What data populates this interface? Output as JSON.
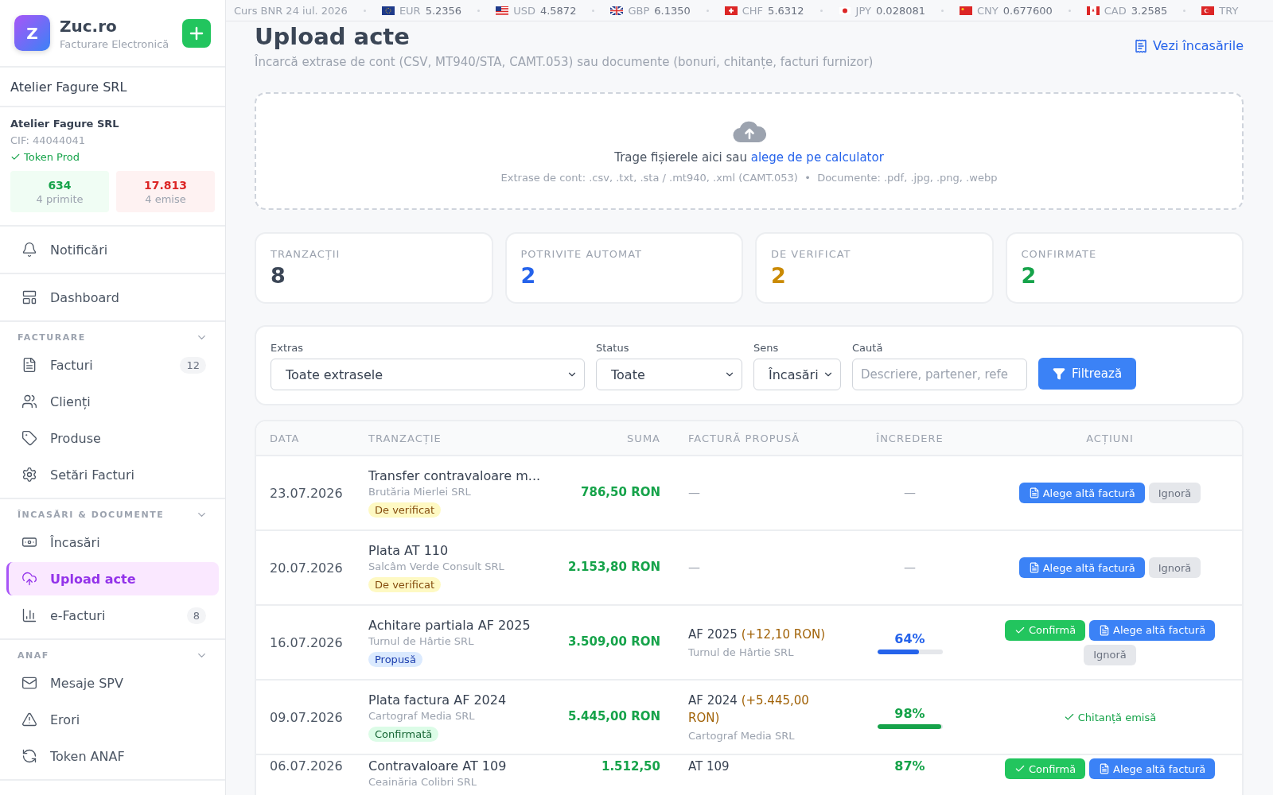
{
  "ticker": {
    "label": "Curs BNR 24 iul. 2026",
    "rates": [
      {
        "code": "EUR",
        "value": "5.2356"
      },
      {
        "code": "USD",
        "value": "4.5872"
      },
      {
        "code": "GBP",
        "value": "6.1350"
      },
      {
        "code": "CHF",
        "value": "5.6312"
      },
      {
        "code": "JPY",
        "value": "0.028081"
      },
      {
        "code": "CNY",
        "value": "0.677600"
      },
      {
        "code": "CAD",
        "value": "3.2585"
      },
      {
        "code": "TRY"
      }
    ]
  },
  "sidebar": {
    "brand": {
      "logo": "Z",
      "name": "Zuc.ro",
      "tagline": "Facturare Electronică"
    },
    "company_selector": "Atelier Fagure SRL",
    "company": {
      "name": "Atelier Fagure SRL",
      "cif": "CIF: 44044041",
      "token": "Token Prod",
      "received": {
        "value": "634",
        "label": "4 primite"
      },
      "issued": {
        "value": "17.813",
        "label": "4 emise"
      }
    },
    "top_items": [
      {
        "label": "Notificări",
        "selected": false
      },
      {
        "label": "Dashboard",
        "selected": false
      }
    ],
    "sections": [
      {
        "title": "FACTURARE",
        "expanded": true,
        "items": [
          {
            "label": "Facturi",
            "count": "12",
            "selected": false
          },
          {
            "label": "Clienți",
            "selected": false
          },
          {
            "label": "Produse",
            "selected": false
          },
          {
            "label": "Setări Facturi",
            "selected": false
          }
        ]
      },
      {
        "title": "ÎNCASĂRI & DOCUMENTE",
        "expanded": true,
        "items": [
          {
            "label": "Încasări",
            "selected": false
          },
          {
            "label": "Upload acte",
            "selected": true
          },
          {
            "label": "e-Facturi",
            "count": "8",
            "selected": false
          }
        ]
      },
      {
        "title": "ANAF",
        "expanded": true,
        "items": [
          {
            "label": "Mesaje SPV",
            "selected": false
          },
          {
            "label": "Erori",
            "selected": false
          },
          {
            "label": "Token ANAF",
            "selected": false
          }
        ]
      }
    ]
  },
  "header": {
    "title": "Upload acte",
    "subtitle": "Încarcă extrase de cont (CSV, MT940/STA, CAMT.053) sau documente (bonuri, chitanțe, facturi furnizor)",
    "link": "Vezi încasările"
  },
  "dropzone": {
    "text": "Trage fișierele aici sau ",
    "link": "alege de pe calculator",
    "hint": "Extrase de cont: .csv, .txt, .sta / .mt940, .xml (CAMT.053)  •  Documente: .pdf, .jpg, .png, .webp"
  },
  "stats": [
    {
      "label": "TRANZACȚII",
      "value": "8",
      "color": "#3b4656"
    },
    {
      "label": "POTRIVITE AUTOMAT",
      "value": "2",
      "color": "#2563eb"
    },
    {
      "label": "DE VERIFICAT",
      "value": "2",
      "color": "#ca8a04"
    },
    {
      "label": "CONFIRMATE",
      "value": "2",
      "color": "#16a34a"
    }
  ],
  "filters": {
    "fields": [
      {
        "kind": "select",
        "label": "Extras",
        "value": "Toate extrasele"
      },
      {
        "kind": "select",
        "label": "Status",
        "value": "Toate"
      },
      {
        "kind": "select",
        "label": "Sens",
        "value": "Încasări"
      },
      {
        "kind": "search",
        "label": "Caută",
        "placeholder": "Descriere, partener, refe"
      }
    ],
    "button": "Filtrează"
  },
  "table": {
    "columns": [
      "DATA",
      "TRANZACȚIE",
      "SUMA",
      "FACTURĂ PROPUSĂ",
      "ÎNCREDERE",
      "ACȚIUNI"
    ],
    "rows": [
      {
        "date": "23.07.2026",
        "title": "Transfer contravaloare m...",
        "partner": "Brutăria Mierlei SRL",
        "status": {
          "kind": "review",
          "label": "De verificat"
        },
        "amount": "786,50 RON",
        "invoice": {
          "kind": "none",
          "text": "—"
        },
        "confidence": {
          "kind": "none",
          "text": "—"
        },
        "actions": [
          {
            "kind": "choose",
            "label": "Alege altă factură"
          },
          {
            "kind": "ignore",
            "label": "Ignoră"
          }
        ]
      },
      {
        "date": "20.07.2026",
        "title": "Plata AT 110",
        "partner": "Salcâm Verde Consult SRL",
        "status": {
          "kind": "review",
          "label": "De verificat"
        },
        "amount": "2.153,80 RON",
        "invoice": {
          "kind": "none",
          "text": "—"
        },
        "confidence": {
          "kind": "none",
          "text": "—"
        },
        "actions": [
          {
            "kind": "choose",
            "label": "Alege altă factură"
          },
          {
            "kind": "ignore",
            "label": "Ignoră"
          }
        ]
      },
      {
        "date": "16.07.2026",
        "title": "Achitare partiala AF 2025",
        "partner": "Turnul de Hârtie SRL",
        "status": {
          "kind": "proposed",
          "label": "Propusă"
        },
        "amount": "3.509,00 RON",
        "invoice": {
          "kind": "match",
          "number": "AF 2025",
          "difference": "(+12,10 RON)",
          "partner": "Turnul de Hârtie SRL"
        },
        "confidence": {
          "kind": "score",
          "text": "64%",
          "level": 0.64,
          "color": "#2563eb"
        },
        "actions": [
          {
            "kind": "confirm",
            "label": "Confirmă"
          },
          {
            "kind": "choose",
            "label": "Alege altă factură"
          },
          {
            "kind": "ignore",
            "label": "Ignoră"
          }
        ]
      },
      {
        "date": "09.07.2026",
        "title": "Plata factura AF 2024",
        "partner": "Cartograf Media SRL",
        "status": {
          "kind": "confirmed",
          "label": "Confirmată"
        },
        "amount": "5.445,00 RON",
        "invoice": {
          "kind": "match",
          "number": "AF 2024",
          "difference": "(+5.445,00 RON)",
          "partner": "Cartograf Media SRL"
        },
        "confidence": {
          "kind": "score",
          "text": "98%",
          "level": 0.98,
          "color": "#16a34a"
        },
        "actions": [
          {
            "kind": "note",
            "label": "Chitanță emisă"
          }
        ]
      },
      {
        "date": "06.07.2026",
        "title": "Contravaloare AT 109",
        "partner": "Ceainăria Colibri SRL",
        "amount": "1.512,50",
        "invoice": {
          "kind": "match",
          "number": "AT 109"
        },
        "confidence": {
          "kind": "score",
          "text": "87%",
          "color": "#16a34a"
        },
        "actions": [
          {
            "kind": "confirm",
            "label": "Confirmă"
          },
          {
            "kind": "choose",
            "label": "Alege altă factură"
          }
        ]
      }
    ]
  }
}
